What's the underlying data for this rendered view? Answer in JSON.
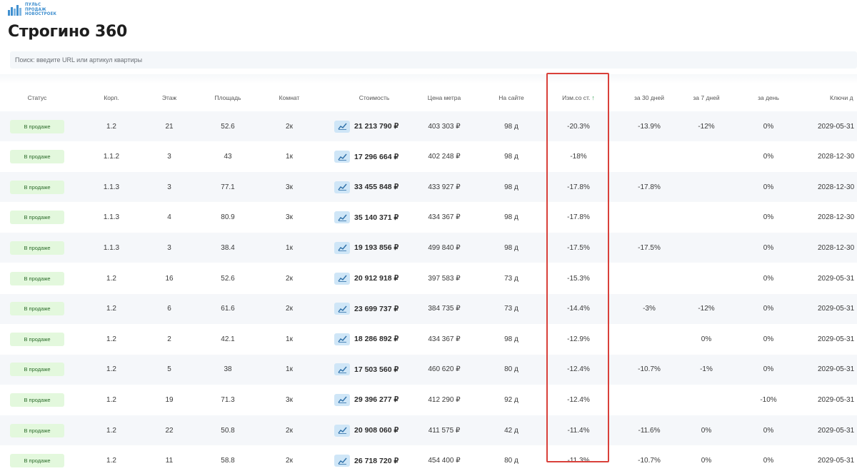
{
  "logo": {
    "lines": [
      "ПУЛЬС",
      "ПРОДАЖ",
      "НОВОСТРОЕК"
    ]
  },
  "page_title": "Строгино 360",
  "search": {
    "placeholder": "Поиск: введите URL или артикул квартиры"
  },
  "columns": {
    "status": "Статус",
    "korp": "Корп.",
    "floor": "Этаж",
    "area": "Площадь",
    "rooms": "Комнат",
    "cost": "Стоимость",
    "price_m": "Цена метра",
    "on_site": "На сайте",
    "change": "Изм.со ст.",
    "d30": "за 30 дней",
    "d7": "за 7 дней",
    "d1": "за день",
    "keys": "Ключи д"
  },
  "sort_indicator": "↑",
  "rows": [
    {
      "status": "В продаже",
      "korp": "1.2",
      "floor": "21",
      "area": "52.6",
      "rooms": "2к",
      "cost": "21 213 790 ₽",
      "price_m": "403 303 ₽",
      "on_site": "98 д",
      "change": "-20.3%",
      "d30": "-13.9%",
      "d7": "-12%",
      "d1": "0%",
      "keys": "2029-05-31"
    },
    {
      "status": "В продаже",
      "korp": "1.1.2",
      "floor": "3",
      "area": "43",
      "rooms": "1к",
      "cost": "17 296 664 ₽",
      "price_m": "402 248 ₽",
      "on_site": "98 д",
      "change": "-18%",
      "d30": "",
      "d7": "",
      "d1": "0%",
      "keys": "2028-12-30"
    },
    {
      "status": "В продаже",
      "korp": "1.1.3",
      "floor": "3",
      "area": "77.1",
      "rooms": "3к",
      "cost": "33 455 848 ₽",
      "price_m": "433 927 ₽",
      "on_site": "98 д",
      "change": "-17.8%",
      "d30": "-17.8%",
      "d7": "",
      "d1": "0%",
      "keys": "2028-12-30"
    },
    {
      "status": "В продаже",
      "korp": "1.1.3",
      "floor": "4",
      "area": "80.9",
      "rooms": "3к",
      "cost": "35 140 371 ₽",
      "price_m": "434 367 ₽",
      "on_site": "98 д",
      "change": "-17.8%",
      "d30": "",
      "d7": "",
      "d1": "0%",
      "keys": "2028-12-30"
    },
    {
      "status": "В продаже",
      "korp": "1.1.3",
      "floor": "3",
      "area": "38.4",
      "rooms": "1к",
      "cost": "19 193 856 ₽",
      "price_m": "499 840 ₽",
      "on_site": "98 д",
      "change": "-17.5%",
      "d30": "-17.5%",
      "d7": "",
      "d1": "0%",
      "keys": "2028-12-30"
    },
    {
      "status": "В продаже",
      "korp": "1.2",
      "floor": "16",
      "area": "52.6",
      "rooms": "2к",
      "cost": "20 912 918 ₽",
      "price_m": "397 583 ₽",
      "on_site": "73 д",
      "change": "-15.3%",
      "d30": "",
      "d7": "",
      "d1": "0%",
      "keys": "2029-05-31"
    },
    {
      "status": "В продаже",
      "korp": "1.2",
      "floor": "6",
      "area": "61.6",
      "rooms": "2к",
      "cost": "23 699 737 ₽",
      "price_m": "384 735 ₽",
      "on_site": "73 д",
      "change": "-14.4%",
      "d30": "-3%",
      "d7": "-12%",
      "d1": "0%",
      "keys": "2029-05-31"
    },
    {
      "status": "В продаже",
      "korp": "1.2",
      "floor": "2",
      "area": "42.1",
      "rooms": "1к",
      "cost": "18 286 892 ₽",
      "price_m": "434 367 ₽",
      "on_site": "98 д",
      "change": "-12.9%",
      "d30": "",
      "d7": "0%",
      "d1": "0%",
      "keys": "2029-05-31"
    },
    {
      "status": "В продаже",
      "korp": "1.2",
      "floor": "5",
      "area": "38",
      "rooms": "1к",
      "cost": "17 503 560 ₽",
      "price_m": "460 620 ₽",
      "on_site": "80 д",
      "change": "-12.4%",
      "d30": "-10.7%",
      "d7": "-1%",
      "d1": "0%",
      "keys": "2029-05-31"
    },
    {
      "status": "В продаже",
      "korp": "1.2",
      "floor": "19",
      "area": "71.3",
      "rooms": "3к",
      "cost": "29 396 277 ₽",
      "price_m": "412 290 ₽",
      "on_site": "92 д",
      "change": "-12.4%",
      "d30": "",
      "d7": "",
      "d1": "-10%",
      "keys": "2029-05-31"
    },
    {
      "status": "В продаже",
      "korp": "1.2",
      "floor": "22",
      "area": "50.8",
      "rooms": "2к",
      "cost": "20 908 060 ₽",
      "price_m": "411 575 ₽",
      "on_site": "42 д",
      "change": "-11.4%",
      "d30": "-11.6%",
      "d7": "0%",
      "d1": "0%",
      "keys": "2029-05-31"
    },
    {
      "status": "В продаже",
      "korp": "1.2",
      "floor": "11",
      "area": "58.8",
      "rooms": "2к",
      "cost": "26 718 720 ₽",
      "price_m": "454 400 ₽",
      "on_site": "80 д",
      "change": "-11.3%",
      "d30": "-10.7%",
      "d7": "0%",
      "d1": "0%",
      "keys": "2029-05-31"
    }
  ],
  "colors": {
    "accent_blue": "#3f8fcf",
    "badge_bg": "#e3f8dd",
    "chart_button_bg": "#cfe6f7",
    "highlight_border": "#d9403a",
    "row_alt": "#f5f7fa"
  }
}
